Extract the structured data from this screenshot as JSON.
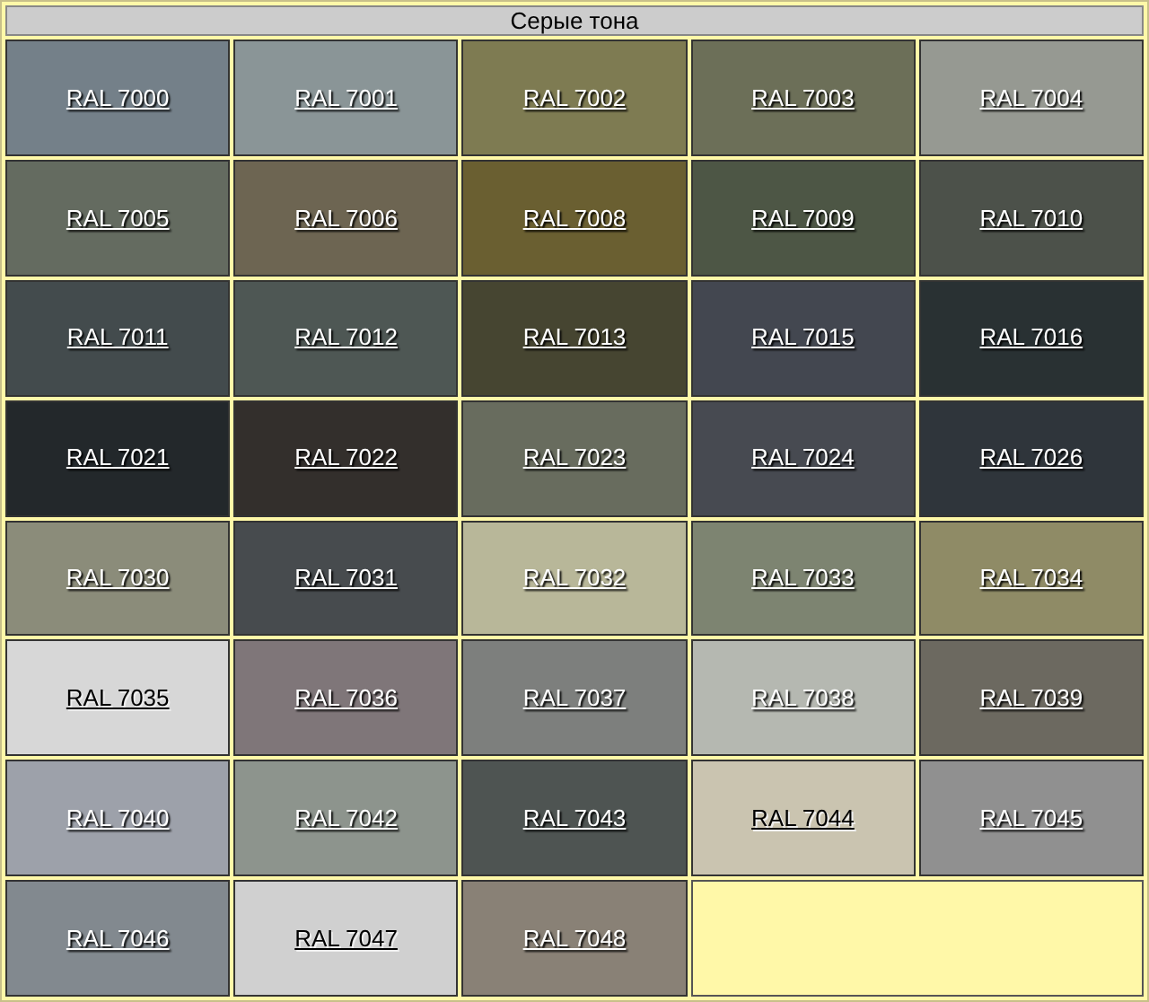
{
  "title": "Серые тона",
  "swatches": [
    {
      "label": "RAL 7000",
      "color": "#748089",
      "dark_text": false
    },
    {
      "label": "RAL 7001",
      "color": "#8a9597",
      "dark_text": false
    },
    {
      "label": "RAL 7002",
      "color": "#7e7b52",
      "dark_text": false
    },
    {
      "label": "RAL 7003",
      "color": "#6c6f58",
      "dark_text": false
    },
    {
      "label": "RAL 7004",
      "color": "#969992",
      "dark_text": false
    },
    {
      "label": "RAL 7005",
      "color": "#646b60",
      "dark_text": false
    },
    {
      "label": "RAL 7006",
      "color": "#6d6552",
      "dark_text": false
    },
    {
      "label": "RAL 7008",
      "color": "#6a5f31",
      "dark_text": false
    },
    {
      "label": "RAL 7009",
      "color": "#4d5645",
      "dark_text": false
    },
    {
      "label": "RAL 7010",
      "color": "#4c514a",
      "dark_text": false
    },
    {
      "label": "RAL 7011",
      "color": "#434b4d",
      "dark_text": false
    },
    {
      "label": "RAL 7012",
      "color": "#4e5754",
      "dark_text": false
    },
    {
      "label": "RAL 7013",
      "color": "#464531",
      "dark_text": false
    },
    {
      "label": "RAL 7015",
      "color": "#434750",
      "dark_text": false
    },
    {
      "label": "RAL 7016",
      "color": "#293133",
      "dark_text": false
    },
    {
      "label": "RAL 7021",
      "color": "#23282b",
      "dark_text": false
    },
    {
      "label": "RAL 7022",
      "color": "#332f2c",
      "dark_text": false
    },
    {
      "label": "RAL 7023",
      "color": "#686c5e",
      "dark_text": false
    },
    {
      "label": "RAL 7024",
      "color": "#474a51",
      "dark_text": false
    },
    {
      "label": "RAL 7026",
      "color": "#2f353b",
      "dark_text": false
    },
    {
      "label": "RAL 7030",
      "color": "#8b8c7a",
      "dark_text": false
    },
    {
      "label": "RAL 7031",
      "color": "#474b4e",
      "dark_text": false
    },
    {
      "label": "RAL 7032",
      "color": "#b8b799",
      "dark_text": false
    },
    {
      "label": "RAL 7033",
      "color": "#7d8471",
      "dark_text": false
    },
    {
      "label": "RAL 7034",
      "color": "#8f8b66",
      "dark_text": false
    },
    {
      "label": "RAL 7035",
      "color": "#d7d7d7",
      "dark_text": true
    },
    {
      "label": "RAL 7036",
      "color": "#7f7679",
      "dark_text": false
    },
    {
      "label": "RAL 7037",
      "color": "#7d7f7d",
      "dark_text": false
    },
    {
      "label": "RAL 7038",
      "color": "#b5b8b1",
      "dark_text": false
    },
    {
      "label": "RAL 7039",
      "color": "#6c6960",
      "dark_text": false
    },
    {
      "label": "RAL 7040",
      "color": "#9da1aa",
      "dark_text": false
    },
    {
      "label": "RAL 7042",
      "color": "#8d948d",
      "dark_text": false
    },
    {
      "label": "RAL 7043",
      "color": "#4e5452",
      "dark_text": false
    },
    {
      "label": "RAL 7044",
      "color": "#cac4b0",
      "dark_text": true
    },
    {
      "label": "RAL 7045",
      "color": "#909090",
      "dark_text": false
    },
    {
      "label": "RAL 7046",
      "color": "#82898f",
      "dark_text": false
    },
    {
      "label": "RAL 7047",
      "color": "#d0d0d0",
      "dark_text": true
    },
    {
      "label": "RAL 7048",
      "color": "#898176",
      "dark_text": false
    }
  ]
}
